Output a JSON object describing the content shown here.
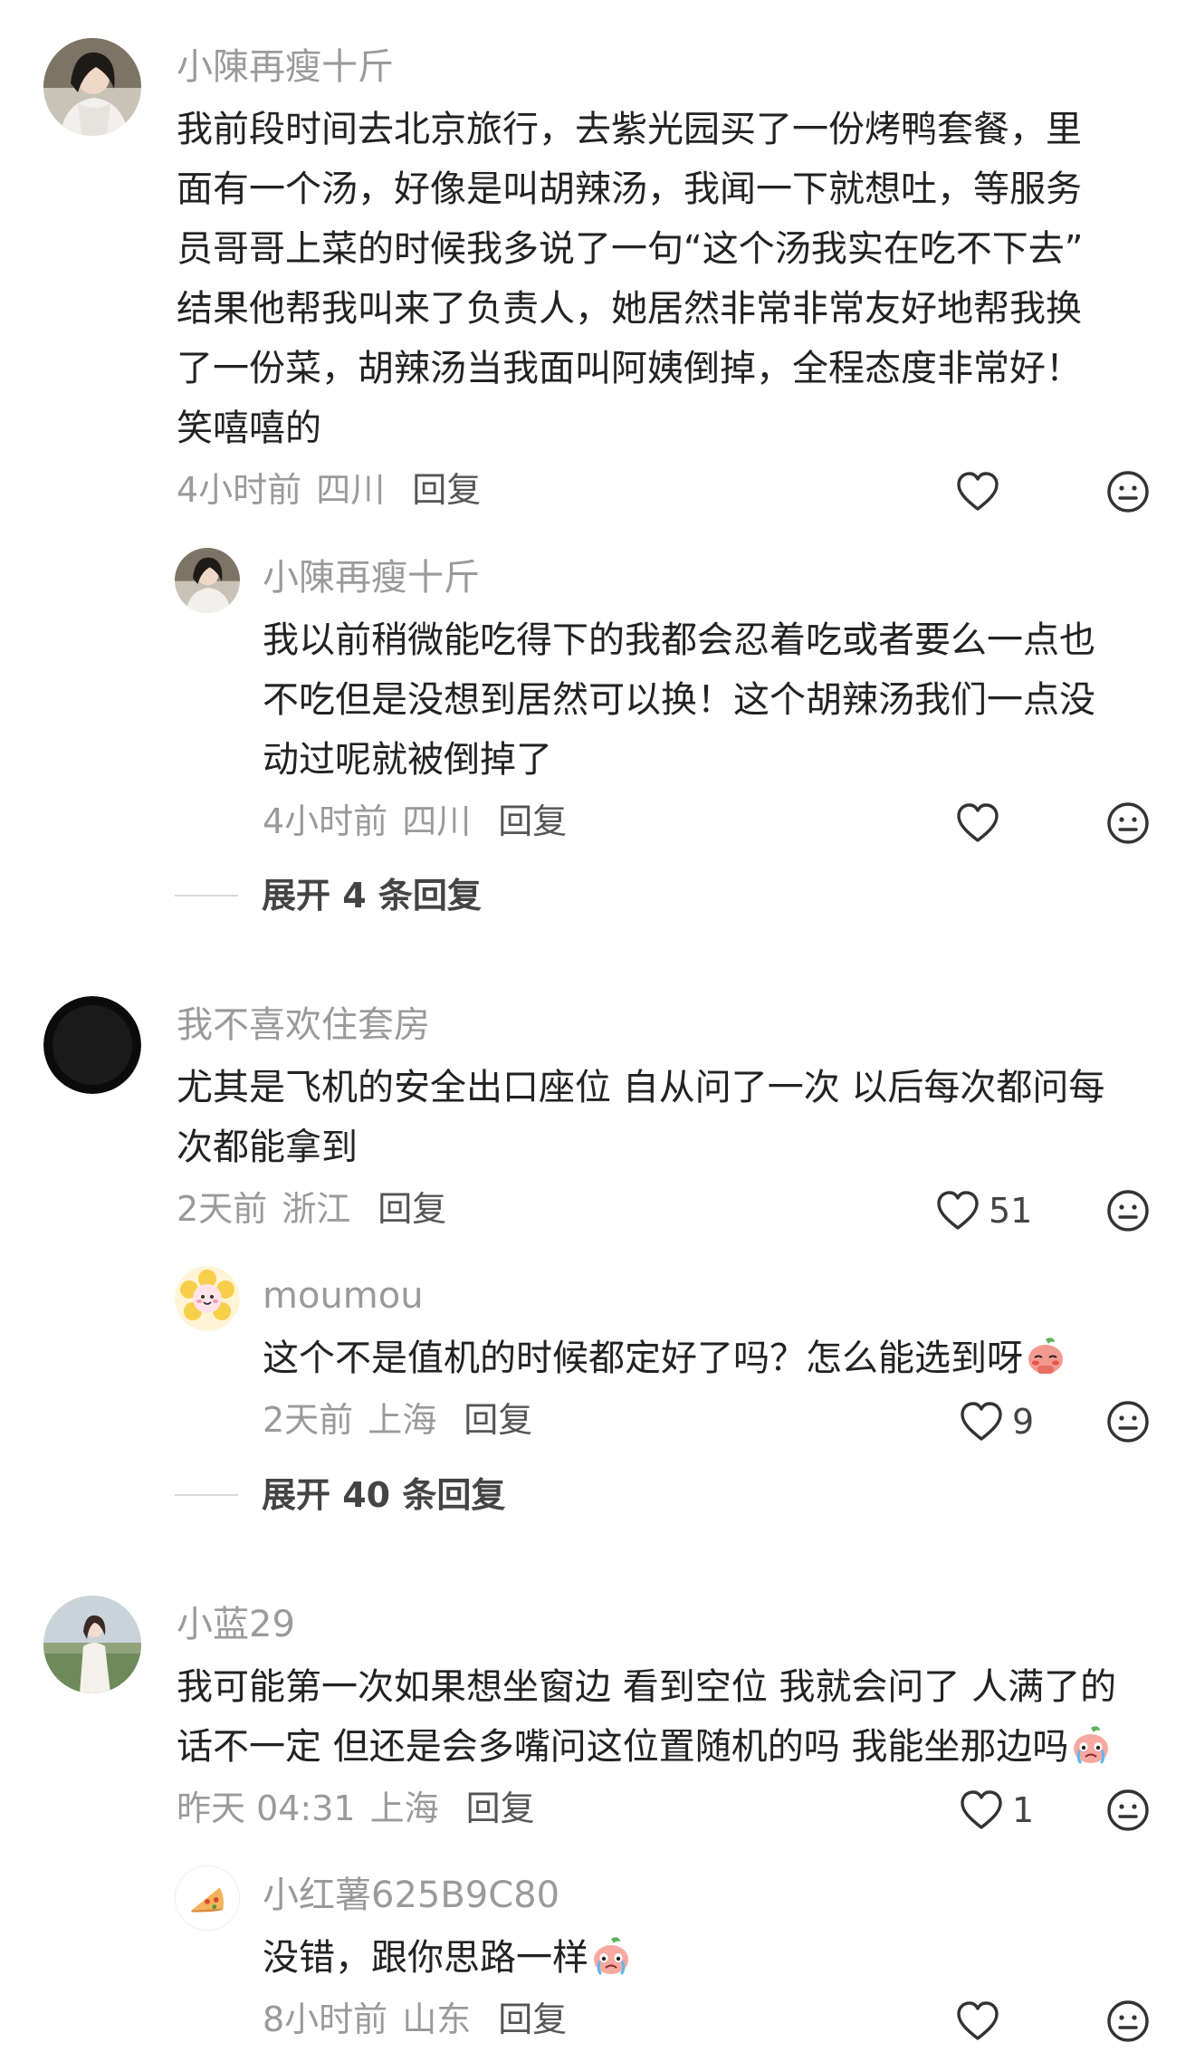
{
  "comments": [
    {
      "user": "小陳再瘦十斤",
      "lines": [
        "我前段时间去北京旅行，去紫光园买了一份烤鸭套餐，里",
        "面有一个汤，好像是叫胡辣汤，我闻一下就想吐，等服务",
        "员哥哥上菜的时候我多说了一句“这个汤我实在吃不下去”",
        "结果他帮我叫来了负责人，她居然非常非常友好地帮我换",
        "了一份菜，胡辣汤当我面叫阿姨倒掉，全程态度非常好！",
        "笑嘻嘻的"
      ],
      "time": "4小时前",
      "location": "四川",
      "reply": "回复",
      "likes": "",
      "replies": [
        {
          "user": "小陳再瘦十斤",
          "lines": [
            "我以前稍微能吃得下的我都会忍着吃或者要么一点也",
            "不吃但是没想到居然可以换！这个胡辣汤我们一点没",
            "动过呢就被倒掉了"
          ],
          "time": "4小时前",
          "location": "四川",
          "reply": "回复",
          "likes": ""
        }
      ],
      "expand": "展开 4 条回复"
    },
    {
      "user": "我不喜欢住套房",
      "lines": [
        "尤其是飞机的安全出口座位 自从问了一次 以后每次都问每",
        "次都能拿到"
      ],
      "time": "2天前",
      "location": "浙江",
      "reply": "回复",
      "likes": "51",
      "replies": [
        {
          "user": "moumou",
          "lines": [
            "这个不是值机的时候都定好了吗？怎么能选到呀"
          ],
          "time": "2天前",
          "location": "上海",
          "reply": "回复",
          "likes": "9"
        }
      ],
      "expand": "展开 40 条回复"
    },
    {
      "user": "小蓝29",
      "lines": [
        "我可能第一次如果想坐窗边 看到空位 我就会问了 人满了的",
        "话不一定 但还是会多嘴问这位置随机的吗 我能坐那边吗"
      ],
      "time": "昨天 04:31",
      "location": "上海",
      "reply": "回复",
      "likes": "1",
      "replies": [
        {
          "user": "小红薯625B9C80",
          "lines": [
            "没错，跟你思路一样"
          ],
          "time": "8小时前",
          "location": "山东",
          "reply": "回复",
          "likes": ""
        }
      ]
    }
  ]
}
